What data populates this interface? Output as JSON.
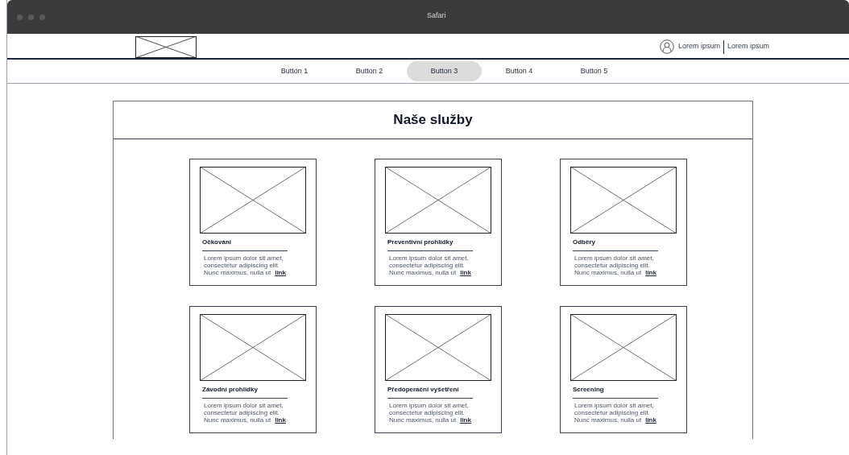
{
  "window": {
    "title": "Safari"
  },
  "header": {
    "links": [
      "Lorem ipsum",
      "Lorem ipsum"
    ]
  },
  "nav": [
    {
      "label": "Button 1",
      "selected": false
    },
    {
      "label": "Button 2",
      "selected": false
    },
    {
      "label": "Button 3",
      "selected": true
    },
    {
      "label": "Button 4",
      "selected": false
    },
    {
      "label": "Button 5",
      "selected": false
    }
  ],
  "section": {
    "title": "Naše služby"
  },
  "cards": [
    {
      "title": "Očkování",
      "description_lines": [
        "Lorem ipsum dolor sit amet,",
        "consectetur adipiscing elit.",
        "Nunc maximus, nulla ut"
      ],
      "link": "link"
    },
    {
      "title": "Preventivní prohlídky",
      "description_lines": [
        "Lorem ipsum dolor sit amet,",
        "consectetur adipiscing elit.",
        "Nunc maximus, nulla ut"
      ],
      "link": "link"
    },
    {
      "title": "Odběry",
      "description_lines": [
        "Lorem ipsum dolor sit amet,",
        "consectetur adipiscing elit.",
        "Nunc maximus, nulla ut"
      ],
      "link": "link"
    },
    {
      "title": "Závodní prohlídky",
      "description_lines": [
        "Lorem ipsum dolor sit amet,",
        "consectetur adipiscing elit.",
        "Nunc maximus, nulla ut"
      ],
      "link": "link"
    },
    {
      "title": "Předoperační vyšetření",
      "description_lines": [
        "Lorem ipsum dolor sit amet,",
        "consectetur adipiscing elit.",
        "Nunc maximus, nulla ut"
      ],
      "link": "link"
    },
    {
      "title": "Screening",
      "description_lines": [
        "Lorem ipsum dolor sit amet,",
        "consectetur adipiscing elit.",
        "Nunc maximus, nulla ut"
      ],
      "link": "link"
    }
  ]
}
